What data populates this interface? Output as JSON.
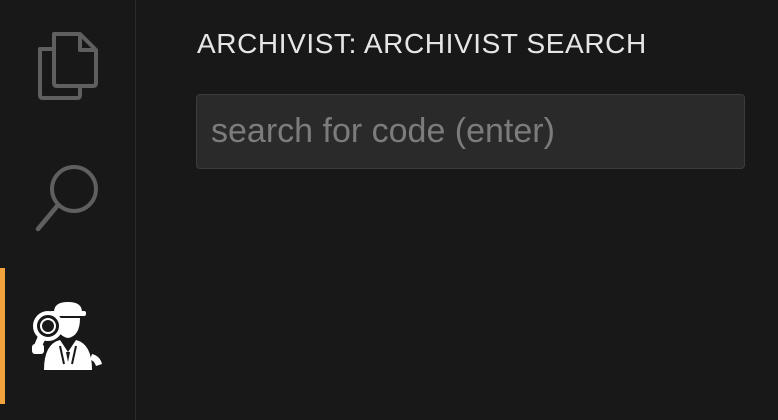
{
  "activity_bar": {
    "items": [
      {
        "icon": "files-icon",
        "active": false
      },
      {
        "icon": "search-icon",
        "active": false
      },
      {
        "icon": "archivist-detective-icon",
        "active": true
      }
    ],
    "accent_color": "#f0a33a"
  },
  "side_panel": {
    "title": "ARCHIVIST: ARCHIVIST SEARCH",
    "search": {
      "value": "",
      "placeholder": "search for code (enter)"
    }
  },
  "colors": {
    "background": "#181818",
    "input_background": "#2a2a2a",
    "text": "#e6e6e6",
    "icon": "#5f5f5f"
  }
}
